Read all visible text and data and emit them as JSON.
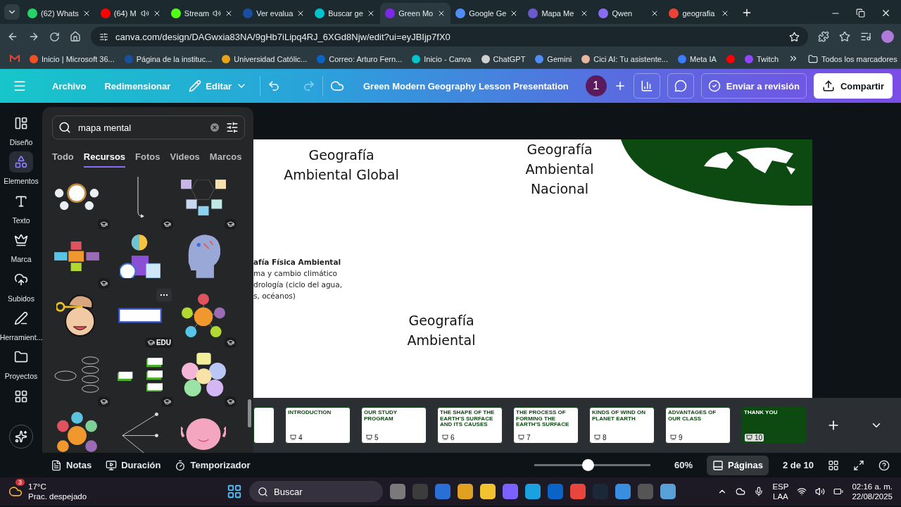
{
  "browser": {
    "tabs": [
      {
        "title": "(62) Whats",
        "color": "#25d366",
        "audio": false,
        "selected": false
      },
      {
        "title": "(64) M",
        "color": "#ff0000",
        "audio": true,
        "selected": false
      },
      {
        "title": "Stream",
        "color": "#53fc18",
        "audio": true,
        "selected": false
      },
      {
        "title": "Ver evalua",
        "color": "#1a4fa0",
        "audio": false,
        "selected": false
      },
      {
        "title": "Buscar ge",
        "color": "#00c4cc",
        "audio": false,
        "selected": false
      },
      {
        "title": "Green Mo",
        "color": "#7d2ae8",
        "audio": false,
        "selected": true
      },
      {
        "title": "Google Ge",
        "color": "#4f8df5",
        "audio": false,
        "selected": false
      },
      {
        "title": "Mapa Me",
        "color": "#6a5acd",
        "audio": false,
        "selected": false
      },
      {
        "title": "Qwen",
        "color": "#8a6cf0",
        "audio": false,
        "selected": false
      },
      {
        "title": "geografia",
        "color": "#ea4335",
        "audio": false,
        "selected": false
      }
    ],
    "url": "canva.com/design/DAGwxia83NA/9gHb7iLipq4RJ_6XGd8Njw/edit?ui=eyJBIjp7fX0",
    "bookmarks": [
      {
        "label": "Inicio | Microsoft 36...",
        "color": "#f25022"
      },
      {
        "label": "Página de la instituc...",
        "color": "#1a4fa0"
      },
      {
        "label": "Universidad Católic...",
        "color": "#e8a317"
      },
      {
        "label": "Correo: Arturo Fern...",
        "color": "#0a64c8"
      },
      {
        "label": "Inicio - Canva",
        "color": "#00c4cc"
      },
      {
        "label": "ChatGPT",
        "color": "#d0d0d0"
      },
      {
        "label": "Gemini",
        "color": "#4f8df5"
      },
      {
        "label": "Cici AI: Tu asistente...",
        "color": "#e9b7a0"
      },
      {
        "label": "Meta IA",
        "color": "#3d7bff"
      },
      {
        "color": "#ff0000"
      },
      {
        "label": "Twitch",
        "color": "#9146ff"
      }
    ],
    "all_bookmarks": "Todos los marcadores"
  },
  "toolbar": {
    "file": "Archivo",
    "resize": "Redimensionar",
    "edit": "Editar",
    "title": "Green Modern Geography Lesson Presentation",
    "collaborator": "1",
    "review": "Enviar a revisión",
    "share": "Compartir"
  },
  "rail": [
    {
      "label": "Diseño",
      "kind": "design",
      "selected": false
    },
    {
      "label": "Elementos",
      "kind": "elements",
      "selected": true
    },
    {
      "label": "Texto",
      "kind": "text",
      "selected": false
    },
    {
      "label": "Marca",
      "kind": "brand",
      "selected": false
    },
    {
      "label": "Subidos",
      "kind": "uploads",
      "selected": false
    },
    {
      "label": "Herramient...",
      "kind": "tools",
      "selected": false
    },
    {
      "label": "Proyectos",
      "kind": "projects",
      "selected": false
    },
    {
      "kind": "apps",
      "selected": false
    }
  ],
  "panel": {
    "search": {
      "value": "mapa mental"
    },
    "filters": [
      {
        "label": "Todo",
        "selected": false
      },
      {
        "label": "Recursos",
        "selected": true
      },
      {
        "label": "Fotos",
        "selected": false
      },
      {
        "label": "Videos",
        "selected": false
      },
      {
        "label": "Marcos",
        "selected": false
      }
    ],
    "assets": [
      {
        "kind": "bubble-map",
        "badge": true
      },
      {
        "kind": "arrow-line",
        "badge": true
      },
      {
        "kind": "hex-flow",
        "badge": true
      },
      {
        "kind": "cross-boxes",
        "badge": true
      },
      {
        "kind": "lightbulb-plant",
        "badge": false
      },
      {
        "kind": "head-profile",
        "badge": false
      },
      {
        "kind": "brain-key-face",
        "badge": false
      },
      {
        "kind": "text-box",
        "badge": true,
        "label": "EDU",
        "menu": true
      },
      {
        "kind": "spoke-circles",
        "badge": true
      },
      {
        "kind": "oval-map",
        "badge": true
      },
      {
        "kind": "box-steps",
        "badge": true
      },
      {
        "kind": "puzzle",
        "badge": true
      },
      {
        "kind": "hexagons",
        "badge": false
      },
      {
        "kind": "line-branches",
        "badge": false
      },
      {
        "kind": "brain-character",
        "badge": false
      }
    ]
  },
  "canvas": {
    "items": [
      {
        "kind": "title",
        "text": "Geografía Ambiental Global"
      },
      {
        "kind": "title",
        "text": "Geografía Ambiental Nacional"
      },
      {
        "kind": "list",
        "heading": "afía Física Ambiental",
        "lines": [
          "ma y cambio climático",
          "drología (ciclo del agua,",
          "s, océanos)"
        ]
      },
      {
        "kind": "title",
        "text": "Geografía Ambiental"
      }
    ]
  },
  "pages": [
    {
      "kind": "cut"
    },
    {
      "kind": "light",
      "number": "4",
      "title": "INTRODUCTION"
    },
    {
      "kind": "light",
      "number": "5",
      "title": "OUR STUDY PROGRAM"
    },
    {
      "kind": "light",
      "number": "6",
      "title": "THE SHAPE OF THE EARTH'S SURFACE AND ITS CAUSES"
    },
    {
      "kind": "light",
      "number": "7",
      "title": "THE PROCESS OF FORMING THE EARTH'S SURFACE"
    },
    {
      "kind": "light",
      "number": "8",
      "title": "KINDS OF WIND ON PLANET EARTH"
    },
    {
      "kind": "light",
      "number": "9",
      "title": "ADVANTAGES OF OUR CLASS"
    },
    {
      "kind": "dark",
      "number": "10",
      "title": "THANK YOU"
    }
  ],
  "footer": {
    "notes": "Notas",
    "duration": "Duración",
    "timer": "Temporizador",
    "zoom": {
      "level": 0.46
    },
    "zoom_reading": "60%",
    "pages": {
      "label": "Páginas",
      "active": true
    },
    "page_count": "2 de 10"
  },
  "taskbar": {
    "weather_badge": "3",
    "temperature": "17°C",
    "weather": "Prac. despejado",
    "search": "Buscar",
    "language": "ESP",
    "layout": "LAA",
    "time": "02:16 a. m.",
    "date": "22/08/2025"
  }
}
